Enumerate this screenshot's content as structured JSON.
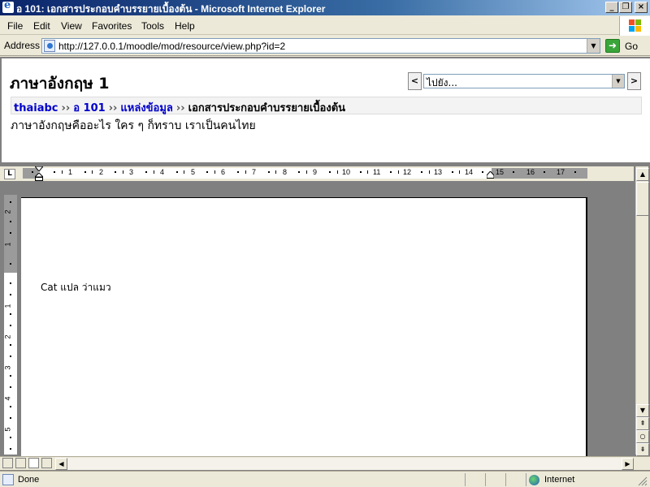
{
  "window": {
    "title": "อ 101: เอกสารประกอบคำบรรยายเบื้องต้น - Microsoft Internet Explorer",
    "min_label": "_",
    "max_label": "❐",
    "close_label": "×"
  },
  "menu": [
    "File",
    "Edit",
    "View",
    "Favorites",
    "Tools",
    "Help"
  ],
  "address": {
    "label": "Address",
    "url": "http://127.0.0.1/moodle/mod/resource/view.php?id=2",
    "go_label": "Go"
  },
  "page": {
    "course_title": "ภาษาอังกฤษ 1",
    "jump": {
      "prev": "<",
      "next": ">",
      "selected": "ไปยัง..."
    },
    "breadcrumb": [
      {
        "label": "thaiabc",
        "link": true
      },
      {
        "label": "อ 101",
        "link": true
      },
      {
        "label": "แหล่งข้อมูล",
        "link": true
      },
      {
        "label": "เอกสารประกอบคำบรรยายเบื้องต้น",
        "link": false
      }
    ],
    "breadcrumb_sep": "››",
    "summary": "ภาษาอังกฤษคืออะไร ใคร ๆ ก็ทราบ เราเป็นคนไทย"
  },
  "word": {
    "tab_selector": "L",
    "ruler_numbers": [
      "1",
      "2",
      "3",
      "4",
      "5",
      "6",
      "7",
      "8",
      "9",
      "10",
      "11",
      "12",
      "13",
      "14",
      "15",
      "16",
      "17"
    ],
    "vruler_numbers": [
      "2",
      "1",
      "1",
      "2",
      "3",
      "4",
      "5"
    ],
    "document_text": "Cat แปล ว่าแมว"
  },
  "status": {
    "text": "Done",
    "zone": "Internet"
  }
}
